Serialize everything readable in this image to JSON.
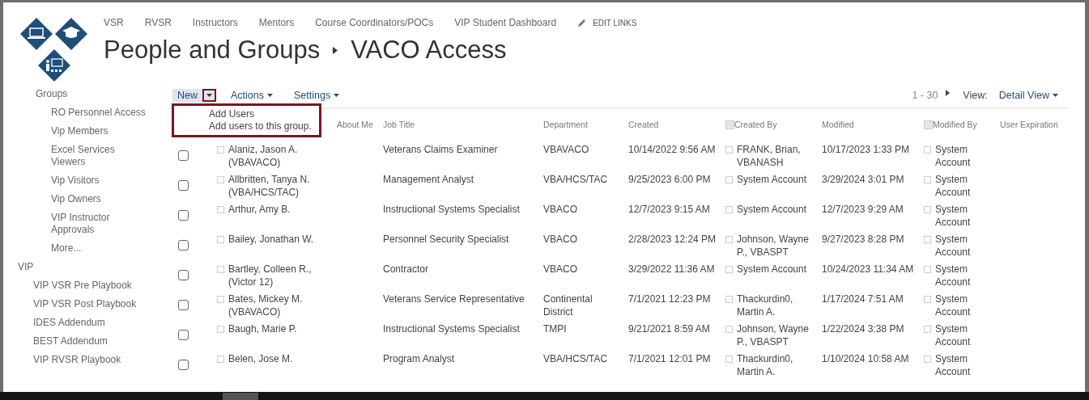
{
  "top_nav": {
    "links": [
      "VSR",
      "RVSR",
      "Instructors",
      "Mentors",
      "Course Coordinators/POCs",
      "VIP Student Dashboard"
    ],
    "edit_links": "EDIT LINKS"
  },
  "breadcrumb": [
    "People and Groups",
    "VACO Access"
  ],
  "sidebar": {
    "items": [
      {
        "label": "Groups",
        "kind": "subheading",
        "children": [
          {
            "label": "RO Personnel Access"
          },
          {
            "label": "Vip Members"
          },
          {
            "label": "Excel Services Viewers"
          },
          {
            "label": "Vip Visitors"
          },
          {
            "label": "Vip Owners"
          },
          {
            "label": "VIP Instructor Approvals"
          },
          {
            "label": "More..."
          }
        ]
      },
      {
        "label": "VIP",
        "kind": "heading",
        "children": [
          {
            "label": "VIP VSR Pre Playbook"
          },
          {
            "label": "VIP VSR Post Playbook"
          },
          {
            "label": "IDES Addendum"
          },
          {
            "label": "BEST Addendum"
          },
          {
            "label": "VIP RVSR Playbook"
          }
        ]
      }
    ]
  },
  "toolbar": {
    "buttons": [
      {
        "label": "New",
        "kind": "split",
        "selected": true
      },
      {
        "label": "Actions",
        "kind": "menu",
        "selected": false
      },
      {
        "label": "Settings",
        "kind": "menu",
        "selected": false
      }
    ],
    "paging": "1 - 30",
    "view_label": "View:",
    "view": "Detail View"
  },
  "new_menu": {
    "items": [
      {
        "title": "Add Users",
        "description": "Add users to this group."
      }
    ]
  },
  "table": {
    "columns": [
      {
        "label": "About Me"
      },
      {
        "label": "Job Title"
      },
      {
        "label": "Department"
      },
      {
        "label": "Created"
      },
      {
        "label": "Created By",
        "kind": "person"
      },
      {
        "label": "Modified"
      },
      {
        "label": "Modified By",
        "kind": "person"
      },
      {
        "label": "User Expiration"
      }
    ],
    "rows": [
      {
        "selected": false,
        "name": "Alaniz, Jason A. (VBAVACO)",
        "job_title": "Veterans Claims Examiner",
        "department": "VBAVACO",
        "created": "10/14/2022 9:56 AM",
        "created_by": "FRANK, Brian, VBANASH",
        "modified": "10/17/2023 1:33 PM",
        "modified_by": "System Account"
      },
      {
        "selected": false,
        "name": "Allbritten, Tanya N. (VBA/HCS/TAC)",
        "job_title": "Management Analyst",
        "department": "VBA/HCS/TAC",
        "created": "9/25/2023 6:00 PM",
        "created_by": "System Account",
        "modified": "3/29/2024 3:01 PM",
        "modified_by": "System Account"
      },
      {
        "selected": false,
        "name": "Arthur, Amy B.",
        "job_title": "Instructional Systems Specialist",
        "department": "VBACO",
        "created": "12/7/2023 9:15 AM",
        "created_by": "System Account",
        "modified": "12/7/2023 9:29 AM",
        "modified_by": "System Account"
      },
      {
        "selected": false,
        "name": "Bailey, Jonathan W.",
        "job_title": "Personnel Security Specialist",
        "department": "VBACO",
        "created": "2/28/2023 12:24 PM",
        "created_by": "Johnson, Wayne P., VBASPT",
        "modified": "9/27/2023 8:28 PM",
        "modified_by": "System Account"
      },
      {
        "selected": false,
        "name": "Bartley, Colleen R., (Victor 12)",
        "job_title": "Contractor",
        "department": "VBACO",
        "created": "3/29/2022 11:36 AM",
        "created_by": "System Account",
        "modified": "10/24/2023 11:34 AM",
        "modified_by": "System Account"
      },
      {
        "selected": false,
        "name": "Bates, Mickey M. (VBAVACO)",
        "job_title": "Veterans Service Representative",
        "department": "Continental District",
        "created": "7/1/2021 12:23 PM",
        "created_by": "Thackurdin0, Martin A.",
        "modified": "1/17/2024 7:51 AM",
        "modified_by": "System Account"
      },
      {
        "selected": false,
        "name": "Baugh, Marie P.",
        "job_title": "Instructional Systems Specialist",
        "department": "TMPI",
        "created": "9/21/2021 8:59 AM",
        "created_by": "Johnson, Wayne P., VBASPT",
        "modified": "1/22/2024 3:38 PM",
        "modified_by": "System Account"
      },
      {
        "selected": false,
        "name": "Belen, Jose M.",
        "job_title": "Program Analyst",
        "department": "VBA/HCS/TAC",
        "created": "7/1/2021 12:01 PM",
        "created_by": "Thackurdin0, Martin A.",
        "modified": "1/10/2024 10:58 AM",
        "modified_by": "System Account"
      }
    ]
  }
}
